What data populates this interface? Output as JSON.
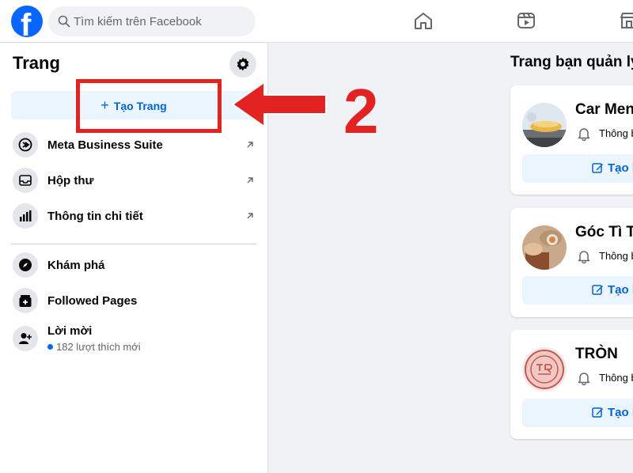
{
  "header": {
    "logo_letter": "f",
    "search_placeholder": "Tìm kiếm trên Facebook",
    "nav_icons": [
      "home-icon",
      "video-icon",
      "marketplace-icon"
    ]
  },
  "sidebar": {
    "title": "Trang",
    "create_button_label": "Tạo Trang",
    "items": [
      {
        "label": "Meta Business Suite",
        "icon": "meta-business-icon",
        "external": true
      },
      {
        "label": "Hộp thư",
        "icon": "inbox-icon",
        "external": true
      },
      {
        "label": "Thông tin chi tiết",
        "icon": "insights-icon",
        "external": true
      },
      {
        "label": "Khám phá",
        "icon": "discover-icon",
        "external": false
      },
      {
        "label": "Followed Pages",
        "icon": "followed-pages-icon",
        "external": false
      },
      {
        "label": "Lời mời",
        "icon": "invite-icon",
        "external": false,
        "sub": "182 lượt thích mới"
      }
    ]
  },
  "annotation": {
    "step_number": "2",
    "color": "#e32222"
  },
  "main": {
    "title": "Trang bạn quản lý",
    "pages": [
      {
        "name": "Car Men",
        "notif": "Thông b",
        "post_label": "Tạo b"
      },
      {
        "name": "Góc Tì Tè",
        "notif": "Thông b",
        "post_label": "Tạo b"
      },
      {
        "name": "TRÒN",
        "notif": "Thông b",
        "post_label": "Tạo b"
      }
    ]
  },
  "colors": {
    "brand": "#0866ff",
    "link_blue": "#0064d1",
    "light_blue_bg": "#ebf5ff",
    "annotation_red": "#e32222"
  }
}
